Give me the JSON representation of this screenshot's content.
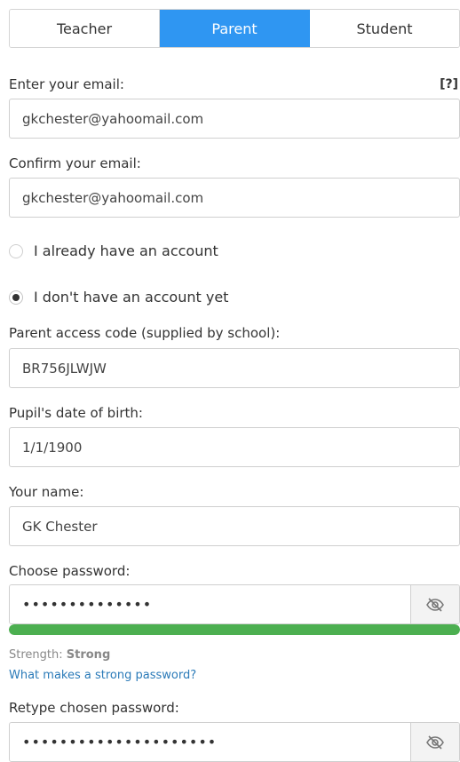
{
  "tabs": [
    {
      "label": "Teacher",
      "active": false
    },
    {
      "label": "Parent",
      "active": true
    },
    {
      "label": "Student",
      "active": false
    }
  ],
  "email": {
    "label": "Enter your email:",
    "help": "[?]",
    "value": "gkchester@yahoomail.com"
  },
  "confirm_email": {
    "label": "Confirm your email:",
    "value": "gkchester@yahoomail.com"
  },
  "account_options": {
    "have_account": "I already have an account",
    "no_account": "I don't have an account yet",
    "selected": "no_account"
  },
  "access_code": {
    "label": "Parent access code (supplied by school):",
    "value": "BR756JLWJW"
  },
  "dob": {
    "label": "Pupil's date of birth:",
    "value": "1/1/1900"
  },
  "name": {
    "label": "Your name:",
    "value": "GK Chester"
  },
  "password": {
    "label": "Choose password:",
    "masked": "••••••••••••••",
    "toggle_icon": "eye-slash-icon"
  },
  "strength": {
    "prefix": "Strength:",
    "value": "Strong",
    "level": 1.0,
    "color": "#4caf50",
    "help_link": "What makes a strong password?"
  },
  "retype_password": {
    "label": "Retype chosen password:",
    "masked": "•••••••••••••••••••••",
    "toggle_icon": "eye-slash-icon"
  },
  "colors": {
    "accent": "#2f96f2",
    "link": "#2a7ab8"
  }
}
